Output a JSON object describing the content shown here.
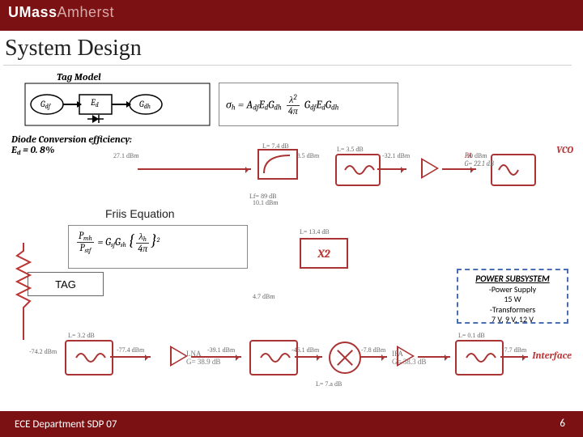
{
  "branding": {
    "logo_text": "UMassAmherst"
  },
  "title": "System Design",
  "tag_model": {
    "label": "Tag Model",
    "gdf": "Gdf",
    "ed": "Ed",
    "gdh": "Gdh"
  },
  "diode_efficiency": {
    "line1": "Diode Conversion efficiency:",
    "line2_prefix": "E",
    "line2_sub": "d",
    "line2_rest": " = 0. 8%"
  },
  "sigma": {
    "lhs": "σh = Adf Ed Gdh",
    "frac_num": "λ²",
    "frac_den": "4π",
    "rhs": "Gdf Ed Gdh"
  },
  "friis": {
    "label": "Friis Equation",
    "num_left": "Pmh",
    "den_left": "Pstf",
    "eq": " = Gsf Gsh ",
    "frac_num": "λh",
    "frac_den": "4π",
    "exp": "2"
  },
  "tag_chip": "TAG",
  "power": {
    "title": "POWER SUBSYSTEM",
    "l1": "-Power Supply",
    "l2": "15 W",
    "l3": "-Transformers",
    "l4": "7 V, 9 V, 12 V"
  },
  "vco_label": "VCO",
  "pa_label": "PA",
  "interface_label": "Interface",
  "x2": "X2",
  "chain_top_text": {
    "a0": "27.1 dBm",
    "curve": "L= 7.4 dB",
    "a1": "-28.5 dBm",
    "filter1": "L= 3.5 dB",
    "a2": "-32.1 dBm",
    "pa": "G= 22.1 dB",
    "a3": "10 dBm",
    "lf": "Lf= 89 dB"
  },
  "mid_text": {
    "t1": "10.1 dBm",
    "t2": "L= 13.4 dB",
    "t3": "4.7 dBm"
  },
  "chain_bot_text": {
    "ant": "L= 3.2 dB",
    "a0": "-74.2 dBm",
    "a1": "-77.4 dBm",
    "lna_t": "LNA",
    "lna_g": "G= 38.9 dB",
    "a2": "-39.1 dBm",
    "a3": "-46.1 dBm",
    "a4": "-7.8 dBm",
    "ifa_t": "IFA",
    "ifa_g": "G= 38.3 dB",
    "f2": "L= 0.1 dB",
    "a5": "-7.7 dBm",
    "lb": "L= 7.a dB"
  },
  "footer": {
    "dept": "ECE Department SDP 07",
    "slide": "6"
  }
}
